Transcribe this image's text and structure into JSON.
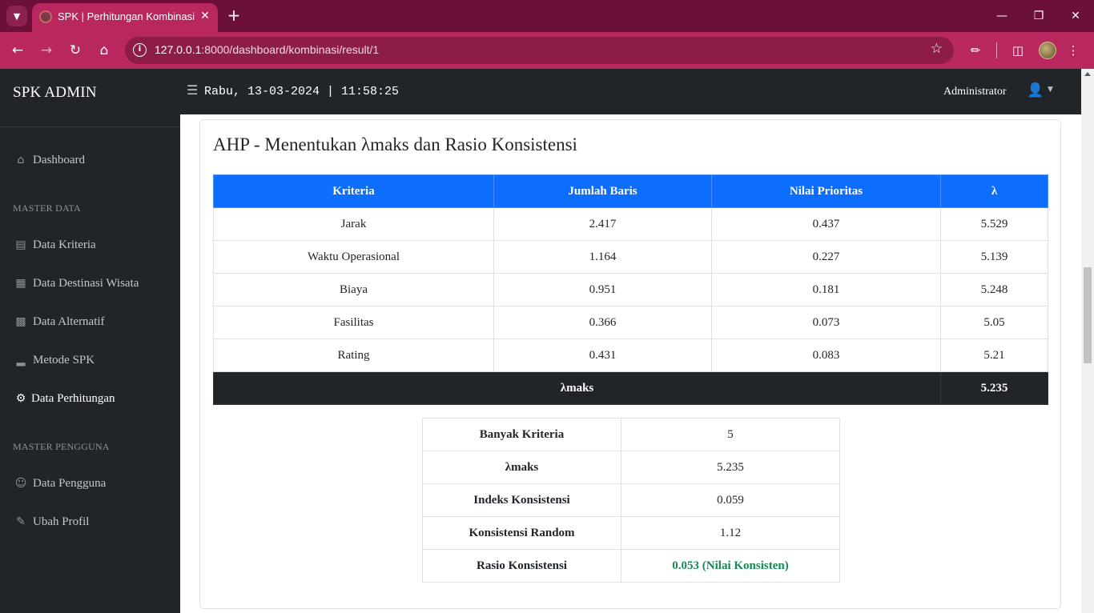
{
  "browser": {
    "tab_title": "SPK | Perhitungan Kombinasi",
    "url_host": "127.0.0.1",
    "url_rest": ":8000/dashboard/kombinasi/result/1",
    "accent": "#b8285f"
  },
  "sidebar": {
    "brand": "SPK ADMIN",
    "dashboard": "Dashboard",
    "master_data_heading": "MASTER DATA",
    "items": [
      {
        "label": "Data Kriteria",
        "icon": "list-icon"
      },
      {
        "label": "Data Destinasi Wisata",
        "icon": "building-icon"
      },
      {
        "label": "Data Alternatif",
        "icon": "cubes-icon"
      },
      {
        "label": "Metode SPK",
        "icon": "chart-icon"
      },
      {
        "label": "Data Perhitungan",
        "icon": "gear-icon",
        "active": true
      }
    ],
    "master_pengguna_heading": "MASTER PENGGUNA",
    "user_items": [
      {
        "label": "Data Pengguna",
        "icon": "users-gear-icon"
      },
      {
        "label": "Ubah Profil",
        "icon": "user-pen-icon"
      }
    ]
  },
  "topbar": {
    "datetime": "Rabu, 13-03-2024 | 11:58:25",
    "user_name": "Administrator"
  },
  "card": {
    "title": "AHP - Menentukan λmaks dan Rasio Konsistensi",
    "table": {
      "headers": [
        "Kriteria",
        "Jumlah Baris",
        "Nilai Prioritas",
        "λ"
      ],
      "rows": [
        [
          "Jarak",
          "2.417",
          "0.437",
          "5.529"
        ],
        [
          "Waktu Operasional",
          "1.164",
          "0.227",
          "5.139"
        ],
        [
          "Biaya",
          "0.951",
          "0.181",
          "5.248"
        ],
        [
          "Fasilitas",
          "0.366",
          "0.073",
          "5.05"
        ],
        [
          "Rating",
          "0.431",
          "0.083",
          "5.21"
        ]
      ],
      "footer_label": "λmaks",
      "footer_value": "5.235"
    },
    "summary": [
      {
        "label": "Banyak Kriteria",
        "value": "5"
      },
      {
        "label": "λmaks",
        "value": "5.235"
      },
      {
        "label": "Indeks Konsistensi",
        "value": "0.059"
      },
      {
        "label": "Konsistensi Random",
        "value": "1.12"
      },
      {
        "label": "Rasio Konsistensi",
        "value": "0.053 (Nilai Konsisten)",
        "status_color": "#198754"
      }
    ]
  }
}
